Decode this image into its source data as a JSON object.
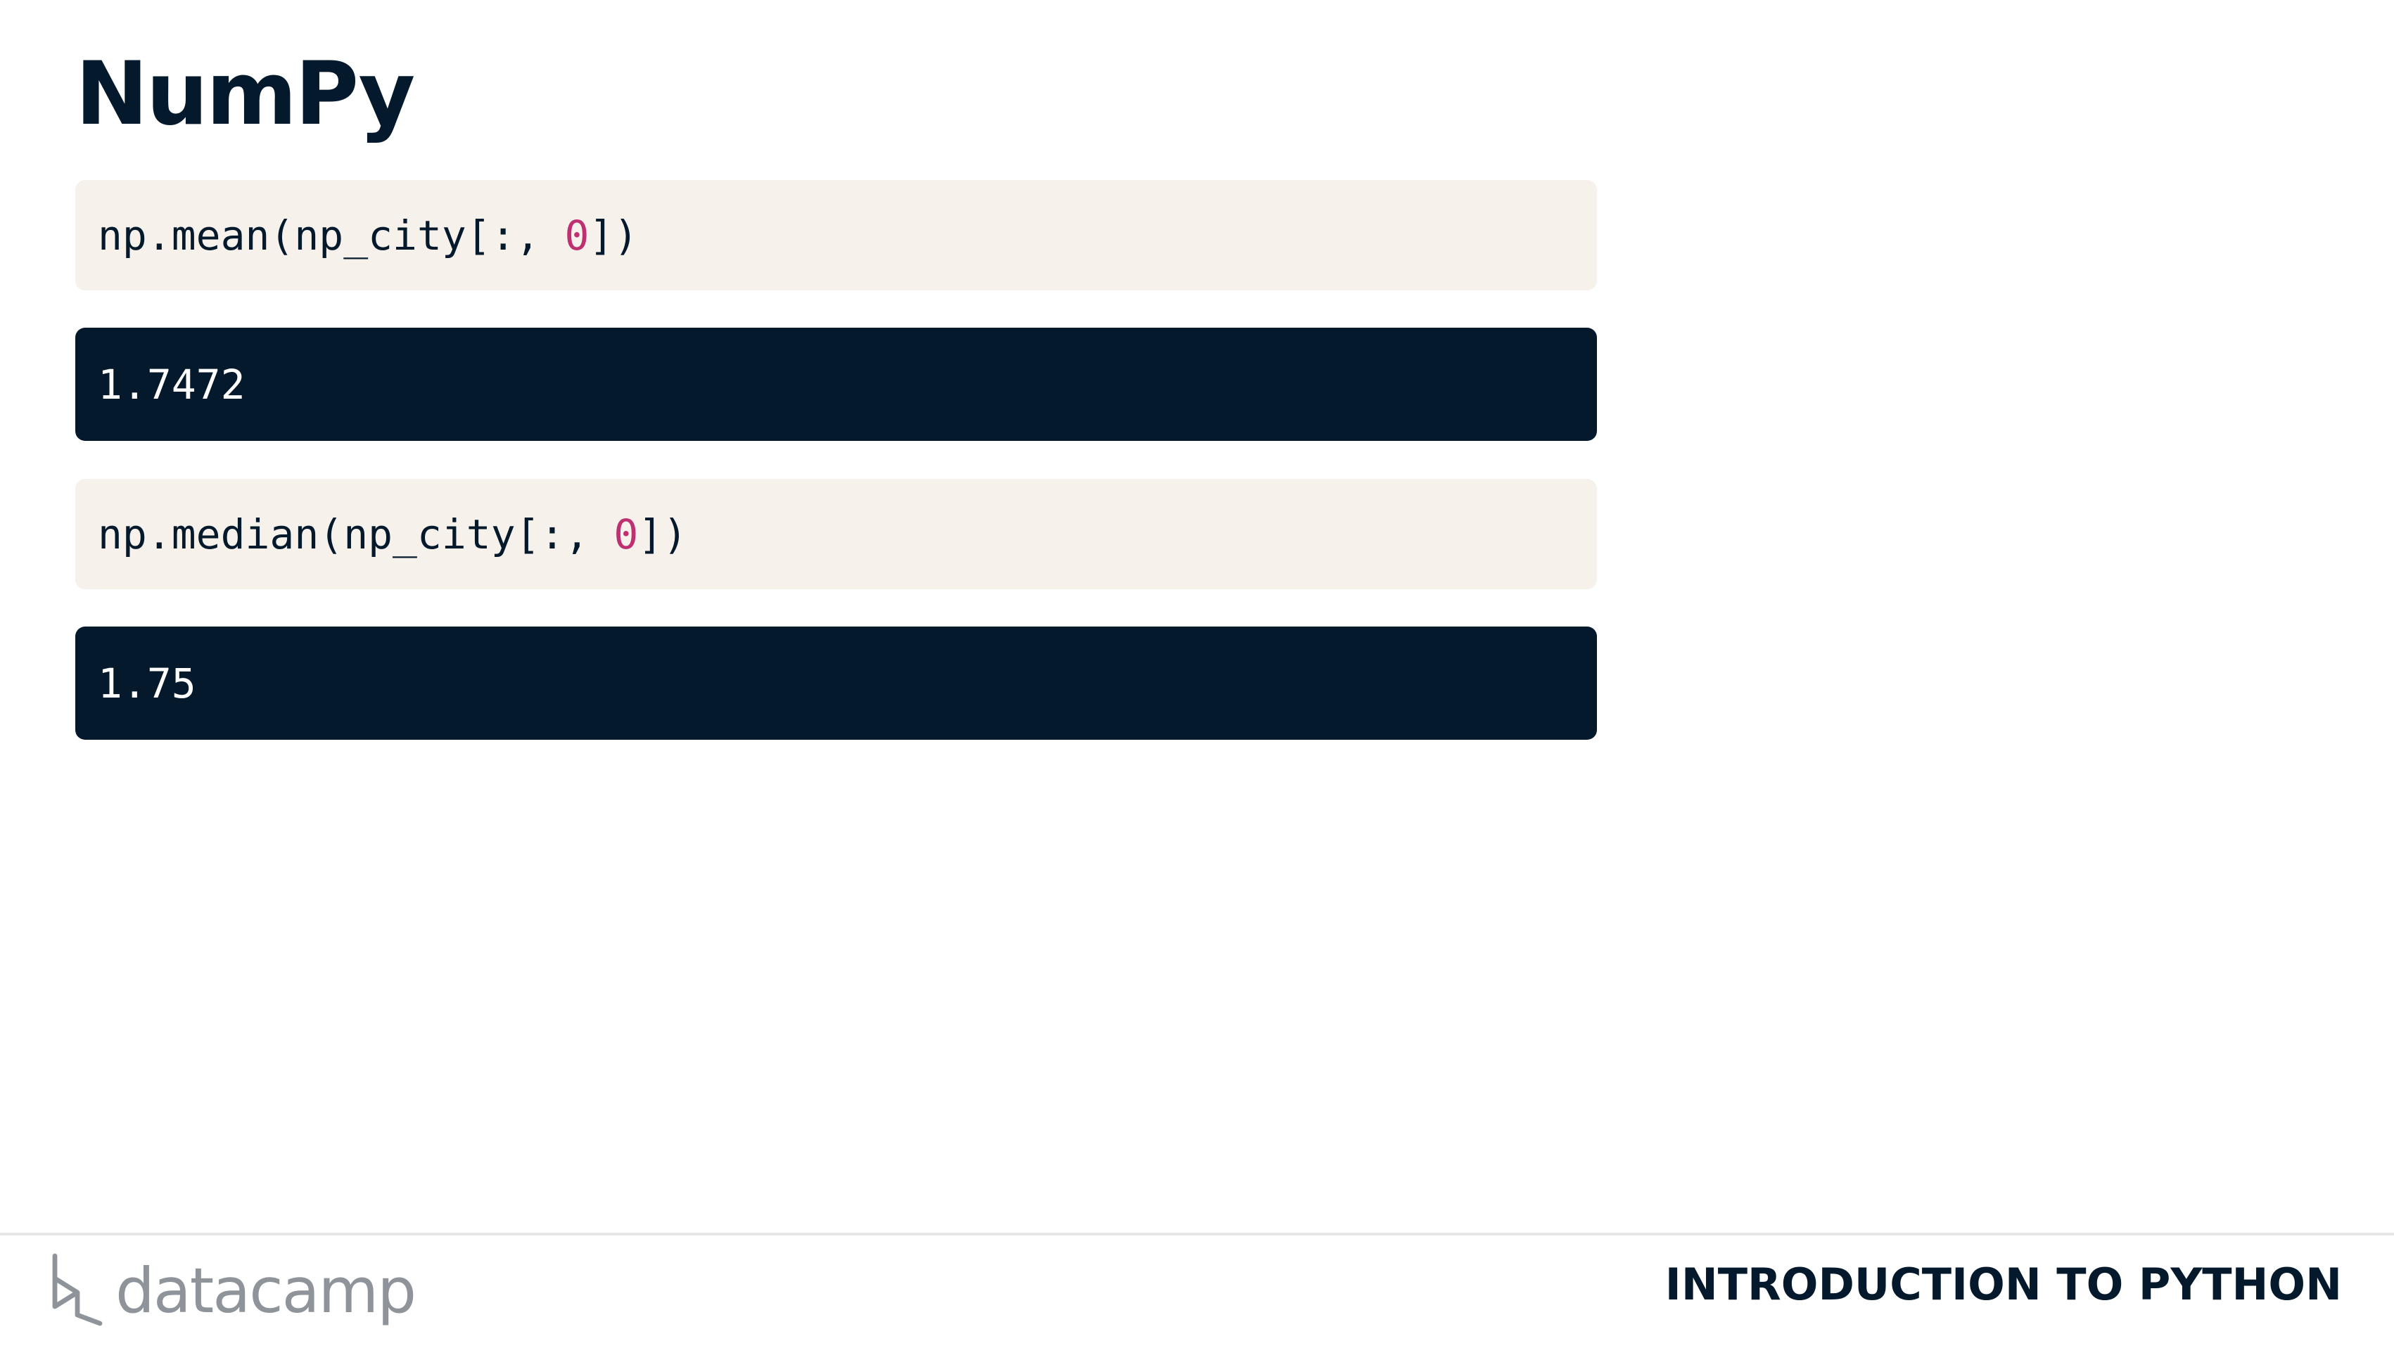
{
  "slide": {
    "title": "NumPy"
  },
  "blocks": [
    {
      "kind": "code",
      "before": "np.mean(np_city[:, ",
      "number": "0",
      "after": "])"
    },
    {
      "kind": "output",
      "text": "1.7472"
    },
    {
      "kind": "code",
      "before": "np.median(np_city[:, ",
      "number": "0",
      "after": "])"
    },
    {
      "kind": "output",
      "text": "1.75"
    }
  ],
  "footer": {
    "logo_text": "datacamp",
    "logo_icon": "datacamp-logo-icon",
    "course_title": "INTRODUCTION TO PYTHON"
  },
  "colors": {
    "navy": "#05192d",
    "code_bg": "#f6f2eb",
    "number": "#bf3072",
    "logo_gray": "#8e9499"
  }
}
